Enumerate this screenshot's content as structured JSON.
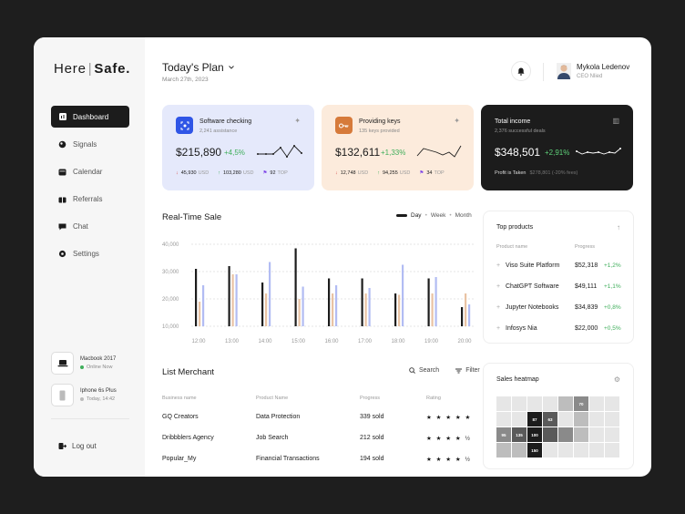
{
  "logo": {
    "part1": "Here",
    "sep": "|",
    "part2": "Safe."
  },
  "nav": [
    {
      "label": "Dashboard"
    },
    {
      "label": "Signals"
    },
    {
      "label": "Calendar"
    },
    {
      "label": "Referrals"
    },
    {
      "label": "Chat"
    },
    {
      "label": "Settings"
    }
  ],
  "devices": [
    {
      "name": "Macbook 2017",
      "status": "Online Now",
      "status_color": "#3fae5b"
    },
    {
      "name": "Iphone 6s Plus",
      "status": "Today, 14:42",
      "status_color": "#bbbbbb"
    }
  ],
  "logout": "Log out",
  "header": {
    "title": "Today's Plan",
    "date": "March 27th, 2023"
  },
  "user": {
    "name": "Mykola Ledenov",
    "role": "CEO Nlied"
  },
  "cards": [
    {
      "title": "Software checking",
      "subtitle": "2,241 assistance",
      "value": "$215,890",
      "change": "+4,5%",
      "down": "45,930",
      "down_unit": "USD",
      "up": "103,280",
      "up_unit": "USD",
      "flag": "92",
      "flag_unit": "TOP",
      "bg": "#e5e9fb",
      "icon_bg": "#2f55e6"
    },
    {
      "title": "Providing keys",
      "subtitle": "135 keys provided",
      "value": "$132,611",
      "change": "+1,33%",
      "down": "12,748",
      "down_unit": "USD",
      "up": "94,255",
      "up_unit": "USD",
      "flag": "34",
      "flag_unit": "TOP",
      "bg": "#fcebdc",
      "icon_bg": "#d67a3a"
    },
    {
      "title": "Total income",
      "subtitle": "2,376 successful deals",
      "value": "$348,501",
      "change": "+2,91%",
      "profit_label": "Profit is Taken",
      "profit_value": "$278,801 (-20% fees)",
      "bg": "#1c1c1c"
    }
  ],
  "realtime": {
    "title": "Real-Time Sale",
    "tabs": [
      "Day",
      "Week",
      "Month"
    ],
    "active_tab": "Day"
  },
  "chart_data": {
    "type": "bar",
    "title": "Real-Time Sale",
    "categories": [
      "12:00",
      "13:00",
      "14:00",
      "15:00",
      "16:00",
      "17:00",
      "18:00",
      "19:00",
      "20:00"
    ],
    "yticks": [
      "40,000",
      "30,000",
      "20,000",
      "10,000"
    ],
    "ylim": [
      10000,
      40000
    ],
    "series": [
      {
        "color": "#1c1c1c",
        "values": [
          31000,
          32000,
          26000,
          38500,
          27500,
          27500,
          22000,
          27500,
          17000
        ]
      },
      {
        "color": "#e9c3a4",
        "values": [
          19000,
          29000,
          22000,
          20000,
          22000,
          22000,
          21500,
          22000,
          22000
        ]
      },
      {
        "color": "#b2bcf3",
        "values": [
          25000,
          29000,
          33500,
          24500,
          25000,
          24000,
          32500,
          28000,
          18000
        ]
      }
    ]
  },
  "merchant": {
    "title": "List Merchant",
    "search": "Search",
    "filter": "Filter",
    "columns": [
      "Business name",
      "Product Name",
      "Progress",
      "Rating"
    ],
    "rows": [
      {
        "business": "GQ Creators",
        "product": "Data Protection",
        "progress": "339 sold",
        "rating": "★ ★ ★ ★ ★"
      },
      {
        "business": "Dribbblers Agency",
        "product": "Job Search",
        "progress": "212 sold",
        "rating": "★ ★ ★ ★ ½"
      },
      {
        "business": "Popular_My",
        "product": "Financial Transactions",
        "progress": "194 sold",
        "rating": "★ ★ ★ ★ ½"
      }
    ]
  },
  "top_products": {
    "title": "Top products",
    "columns": [
      "Product name",
      "Progress"
    ],
    "rows": [
      {
        "name": "Viso Suite Platform",
        "price": "$52,318",
        "change": "+1,2%"
      },
      {
        "name": "ChatGPT Software",
        "price": "$49,111",
        "change": "+1,1%"
      },
      {
        "name": "Jupyter Notebooks",
        "price": "$34,839",
        "change": "+0,8%"
      },
      {
        "name": "Infosys Nia",
        "price": "$22,000",
        "change": "+0,5%"
      }
    ]
  },
  "heatmap": {
    "title": "Sales heatmap",
    "cells": [
      [
        "#e6e6e6",
        "#e6e6e6",
        "#e6e6e6",
        "#e6e6e6",
        "#bdbdbd",
        "#8a8a8a",
        "#e6e6e6",
        "#e6e6e6"
      ],
      [
        "#e6e6e6",
        "#e6e6e6",
        "#1c1c1c",
        "#5a5a5a",
        "#e6e6e6",
        "#bdbdbd",
        "#e6e6e6",
        "#e6e6e6"
      ],
      [
        "#8a8a8a",
        "#5a5a5a",
        "#1c1c1c",
        "#5a5a5a",
        "#8a8a8a",
        "#bdbdbd",
        "#e6e6e6",
        "#e6e6e6"
      ],
      [
        "#bdbdbd",
        "#bdbdbd",
        "#1c1c1c",
        "#e6e6e6",
        "#e6e6e6",
        "#e6e6e6",
        "#e6e6e6",
        "#e6e6e6"
      ]
    ],
    "labels": [
      [
        "",
        "",
        "",
        "",
        "",
        "70",
        "",
        ""
      ],
      [
        "",
        "",
        "87",
        "63",
        "",
        "",
        "",
        ""
      ],
      [
        "95",
        "135",
        "100",
        "",
        "",
        "",
        "",
        ""
      ],
      [
        "",
        "",
        "150",
        "",
        "",
        "",
        "",
        ""
      ]
    ]
  }
}
